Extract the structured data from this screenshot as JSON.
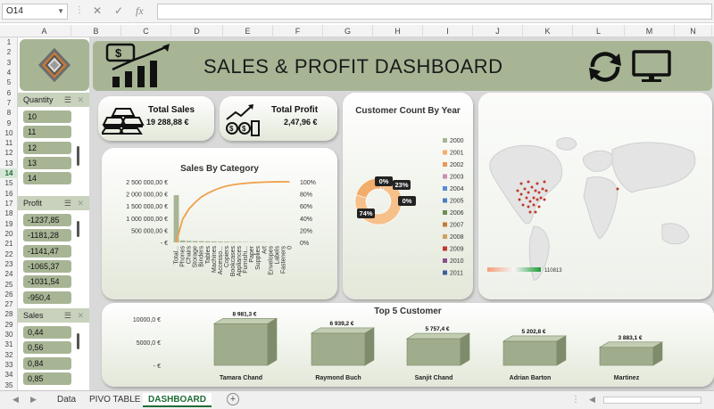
{
  "formula_bar": {
    "name_box": "O14",
    "cancel_icon": "✕",
    "enter_icon": "✓",
    "fx_icon": "fx",
    "formula": ""
  },
  "columns": [
    "A",
    "B",
    "C",
    "D",
    "E",
    "F",
    "G",
    "H",
    "I",
    "J",
    "K",
    "L",
    "M",
    "N"
  ],
  "rows": [
    "1",
    "2",
    "3",
    "4",
    "5",
    "6",
    "7",
    "8",
    "9",
    "10",
    "11",
    "12",
    "13",
    "14",
    "15",
    "16",
    "17",
    "18",
    "19",
    "20",
    "21",
    "22",
    "23",
    "24",
    "25",
    "26",
    "27",
    "28",
    "29",
    "30",
    "31",
    "32",
    "33",
    "34",
    "35"
  ],
  "selected_row": "14",
  "dashboard": {
    "title": "SALES & PROFIT DASHBOARD",
    "total_sales": {
      "label": "Total Sales",
      "value": "19 288,88 €"
    },
    "total_profit": {
      "label": "Total Profit",
      "value": "2,47,96 €"
    }
  },
  "slicers": [
    {
      "title": "Quantity",
      "items": [
        "10",
        "11",
        "12",
        "13",
        "14"
      ]
    },
    {
      "title": "Profit",
      "items": [
        "-1237,85",
        "-1181,28",
        "-1141,47",
        "-1065,37",
        "-1031,54",
        "-950,4"
      ]
    },
    {
      "title": "Sales",
      "items": [
        "0,44",
        "0,56",
        "0,84",
        "0,85"
      ]
    }
  ],
  "chart_data": [
    {
      "type": "bar",
      "title": "Sales By Category",
      "categories": [
        "Total...",
        "Phones",
        "Chairs",
        "Storage",
        "Binders",
        "Tables",
        "Machines",
        "Accesso...",
        "Copiers",
        "Bookcases",
        "Appliances",
        "Furnishi...",
        "Paper",
        "Supplies",
        "Art",
        "Envelopes",
        "Labels",
        "Fasteners",
        "0"
      ],
      "series": [
        {
          "values": [
            1950000,
            80000,
            62000,
            55000,
            50000,
            45000,
            40000,
            35000,
            30000,
            24000,
            18000,
            15000,
            12000,
            10000,
            8000,
            6000,
            4000,
            3000,
            0
          ]
        },
        {
          "axis": "secondary",
          "values": [
            0,
            0.38,
            0.55,
            0.66,
            0.75,
            0.81,
            0.86,
            0.9,
            0.93,
            0.95,
            0.965,
            0.975,
            0.984,
            0.99,
            0.994,
            0.997,
            0.999,
            1.0,
            1.0
          ]
        }
      ],
      "y_ticks": [
        "2 500 000,00 €",
        "2 000 000,00 €",
        "1 500 000,00 €",
        "1 000 000,00 €",
        "500 000,00 €",
        "-   €"
      ],
      "y2_ticks": [
        "100%",
        "80%",
        "60%",
        "40%",
        "20%",
        "0%"
      ],
      "ylim": [
        0,
        2500000
      ],
      "y2lim": [
        0,
        1
      ]
    },
    {
      "type": "pie",
      "title": "Customer Count By Year",
      "slices": [
        {
          "label": "74%",
          "value": 74
        },
        {
          "label": "23%",
          "value": 23
        },
        {
          "label": "0%",
          "value": 1.5
        },
        {
          "label": "0%",
          "value": 1.5
        }
      ],
      "legend": [
        "2000",
        "2001",
        "2002",
        "2003",
        "2004",
        "2005",
        "2006",
        "2007",
        "2008",
        "2009",
        "2010",
        "2011"
      ],
      "legend_placement": "right"
    },
    {
      "type": "bar",
      "title": "Top 5 Customer",
      "categories": [
        "Tamara Chand",
        "Raymond Buch",
        "Sanjit Chand",
        "Adrian Barton",
        "Martinez"
      ],
      "values": [
        8981.3,
        6939.2,
        5757.4,
        5202.8,
        3883.1
      ],
      "data_labels": [
        "8 981,3 €",
        "6 939,2 €",
        "5 757,4 €",
        "5 202,8 €",
        "3 883,1 €"
      ],
      "y_ticks": [
        "10000,0 €",
        "5000,0 €",
        "-   €"
      ],
      "ylim": [
        0,
        10000
      ]
    }
  ],
  "map": {
    "legend_max": "110813"
  },
  "colors": {
    "panel": "#a7b595",
    "bar": "#a7b595",
    "line": "#f0a04b",
    "donut_main": "#f5c08a",
    "accent_green": "#1e6b35"
  },
  "tabs": [
    "Data",
    "PIVO TABLE",
    "DASHBOARD"
  ],
  "active_tab": "DASHBOARD"
}
